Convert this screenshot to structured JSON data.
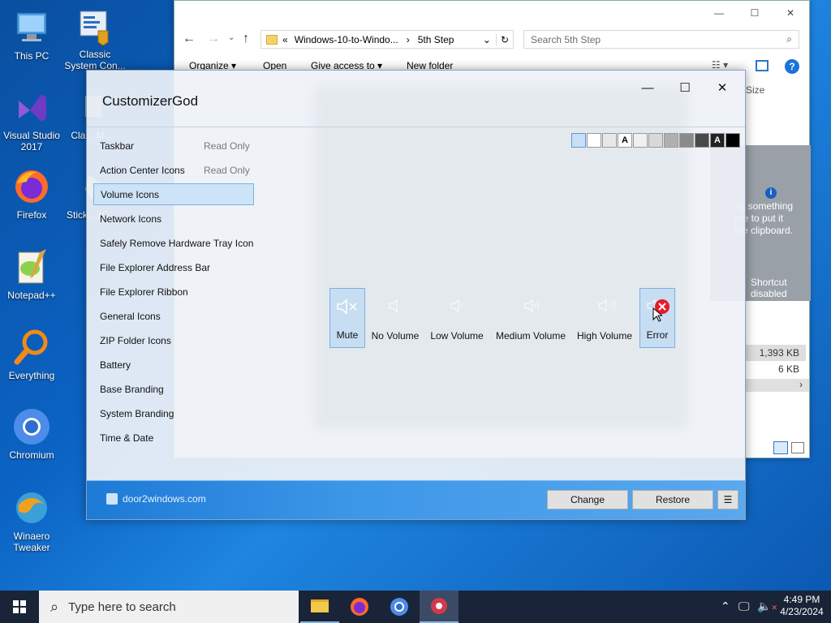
{
  "desktop": {
    "icons": [
      {
        "label": "This PC"
      },
      {
        "label": "Classic System Con..."
      },
      {
        "label": "Visual Studio 2017"
      },
      {
        "label": "Cla... M..."
      },
      {
        "label": "Firefox"
      },
      {
        "label": "Stick... (C..."
      },
      {
        "label": "Notepad++"
      },
      {
        "label": "Everything"
      },
      {
        "label": "Chromium"
      },
      {
        "label": "Winaero Tweaker"
      }
    ]
  },
  "explorer": {
    "breadcrumb": [
      "«",
      "Windows-10-to-Windo...",
      "5th Step"
    ],
    "search_placeholder": "Search 5th Step",
    "toolbar": {
      "organize": "Organize",
      "open": "Open",
      "give_access": "Give access to",
      "new_folder": "New folder"
    },
    "column_size": "Size",
    "preview_msg": "Drag something here to put it on the clipboard.",
    "preview_msg_lines": [
      "ag something",
      "ere to put it",
      "the clipboard."
    ],
    "shortcut": "Shortcut disabled",
    "shortcut_lines": [
      "Shortcut",
      "disabled"
    ],
    "sizes": [
      "1,393 KB",
      "6 KB"
    ]
  },
  "customizer": {
    "title": "CustomizerGod",
    "sidebar": [
      {
        "label": "Taskbar",
        "note": "Read Only"
      },
      {
        "label": "Action Center Icons",
        "note": "Read Only"
      },
      {
        "label": "Volume Icons",
        "selected": true
      },
      {
        "label": "Network Icons"
      },
      {
        "label": "Safely Remove Hardware Tray Icon"
      },
      {
        "label": "File Explorer Address Bar"
      },
      {
        "label": "File Explorer Ribbon"
      },
      {
        "label": "General Icons"
      },
      {
        "label": "ZIP Folder Icons"
      },
      {
        "label": "Battery"
      },
      {
        "label": "Base Branding"
      },
      {
        "label": "System Branding"
      },
      {
        "label": "Time & Date"
      }
    ],
    "swatch_letter": "A",
    "swatch_colors": [
      "#c8dff5",
      "#ffffff",
      "#e8e8e8",
      "#ffffff",
      "#f0f0f0",
      "#d8d8d8",
      "#b0b0b0",
      "#8a8a8a",
      "#4a4a4a",
      "#222222",
      "#000000"
    ],
    "volume_icons": [
      "Mute",
      "No Volume",
      "Low Volume",
      "Medium Volume",
      "High Volume",
      "Error"
    ],
    "footer_link": "door2windows.com",
    "change_label": "Change",
    "restore_label": "Restore",
    "menu_glyph": "☰"
  },
  "taskbar": {
    "search_placeholder": "Type here to search",
    "time": "4:49 PM",
    "date": "4/23/2024"
  }
}
